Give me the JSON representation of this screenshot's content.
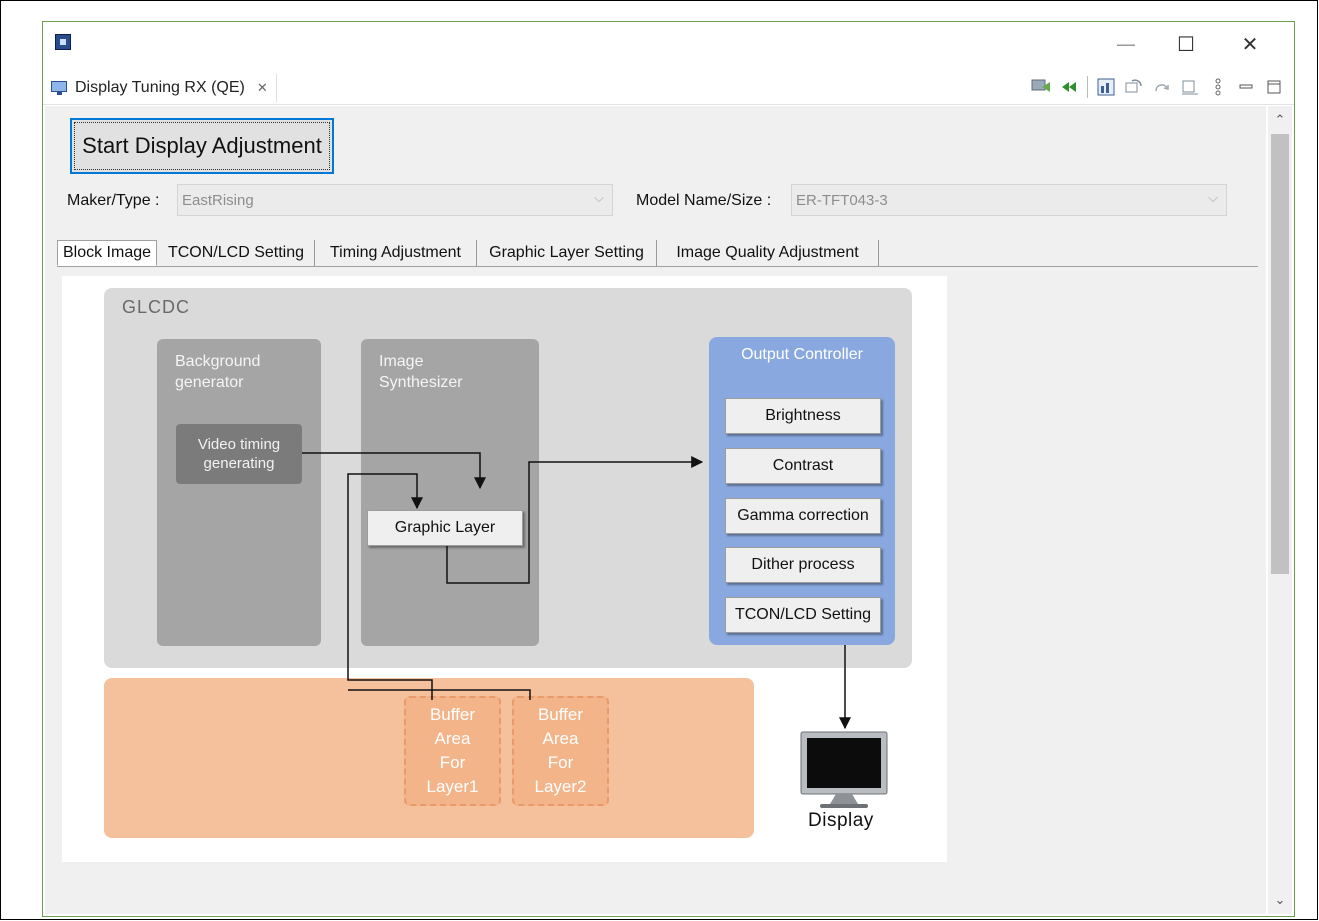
{
  "window": {
    "icon": "renesas-app-icon",
    "controls": {
      "minimize": "—",
      "maximize": "☐",
      "close": "✕"
    }
  },
  "view": {
    "tab_label": "Display Tuning RX (QE)",
    "tab_close": "✕",
    "toolbar_icons": [
      "connect-icon",
      "rewind-icon",
      "chart-icon",
      "refresh-icon",
      "redo-icon",
      "panel-icon",
      "more-icon",
      "minimize-view-icon",
      "maximize-view-icon"
    ]
  },
  "form": {
    "start_button": "Start Display Adjustment",
    "maker_label": "Maker/Type :",
    "maker_value": "EastRising",
    "model_label": "Model Name/Size :",
    "model_value": "ER-TFT043-3"
  },
  "tabs": [
    {
      "label": "Block Image",
      "active": true
    },
    {
      "label": "TCON/LCD Setting",
      "active": false
    },
    {
      "label": "Timing Adjustment",
      "active": false
    },
    {
      "label": "Graphic Layer Setting",
      "active": false
    },
    {
      "label": "Image Quality Adjustment",
      "active": false
    }
  ],
  "diagram": {
    "glcdc_title": "GLCDC",
    "background_generator": "Background\ngenerator",
    "video_timing": "Video timing\ngenerating",
    "image_synthesizer": "Image\nSynthesizer",
    "graphic_layer": "Graphic Layer",
    "output_controller": "Output Controller",
    "output_items": [
      "Brightness",
      "Contrast",
      "Gamma correction",
      "Dither process",
      "TCON/LCD Setting"
    ],
    "buffer1": "Buffer\nArea\nFor\nLayer1",
    "buffer2": "Buffer\nArea\nFor\nLayer2",
    "display_label": "Display"
  },
  "colors": {
    "glcdc_bg": "#dadada",
    "block_bg": "#a5a5a5",
    "output_controller_bg": "#8aa8e0",
    "buffer_bg": "#f5c09c",
    "focus_border": "#0078d7"
  }
}
